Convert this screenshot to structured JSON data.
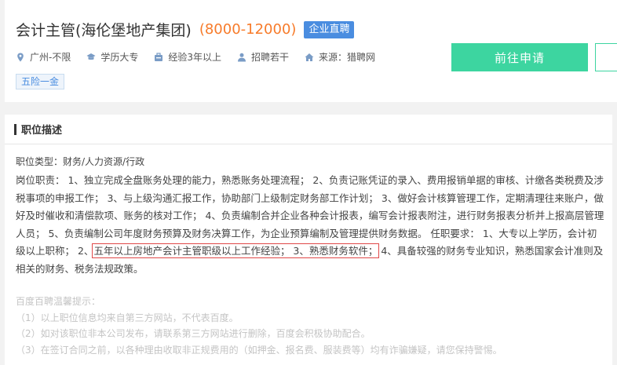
{
  "job": {
    "title": "会计主管(海伦堡地产集团)",
    "salary": "(8000-12000)",
    "badge": "企业直聘",
    "meta": {
      "location": "广州-不限",
      "education": "学历大专",
      "experience": "经验3年以上",
      "headcount": "招聘若干",
      "source": "来源：猎聘网"
    },
    "tags": [
      "五险一金"
    ],
    "apply_label": "前往申请"
  },
  "description": {
    "section_title": "职位描述",
    "job_type": "职位类型：财务/人力资源/行政",
    "text_before": "岗位职责： 1、独立完成全盘账务处理的能力，熟悉账务处理流程； 2、负责记账凭证的录入、费用报销单据的审核、计缴各类税费及涉税事项的申报工作； 3、与上级沟通汇报工作，协助部门上级制定财务部工作计划； 3、做好会计核算管理工作，定期清理往来账户，做好及时催收和清偿款项、账务的核对工作； 4、负责编制合并企业各种会计报表，编写会计报表附注，进行财务报表分析并上报高层管理人员； 5、负责编制公司年度财务预算及财务决算工作，为企业预算编制及管理提供财务数据。 任职要求： 1、大专以上学历，会计初级以上职称； 2、",
    "text_highlight": "五年以上房地产会计主管职级以上工作经验； 3、熟悉财务软件；",
    "text_after": " 4、具备较强的财务专业知识，熟悉国家会计准则及相关的财务、税务法规政策。"
  },
  "tips": {
    "title": "百度百聘温馨提示：",
    "items": [
      "（1）以上职位信息均来自第三方网站，不代表百度。",
      "（2）如对该职位非本公司发布，请联系第三方网站进行删除，百度会积极协助配合。",
      "（3）在签订合同之前，以各种理由收取非正规费用的（如押金、报名费、服装费等）均有诈骗嫌疑，请您保持警惕。"
    ]
  },
  "colors": {
    "accent": "#3dd5a0",
    "salary": "#f77b2a",
    "badge": "#4a8de0",
    "highlight_border": "#e04848"
  }
}
